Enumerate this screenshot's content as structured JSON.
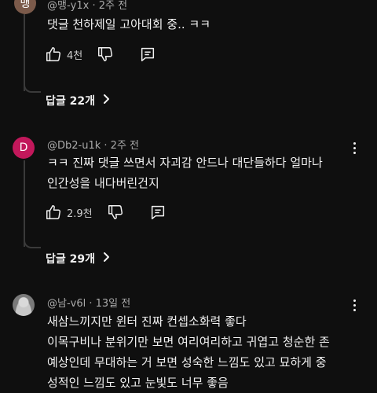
{
  "comments": [
    {
      "avatar_text": "맹",
      "avatar_color": "#7b5a4a",
      "handle": "@맹-y1x",
      "time": "2주 전",
      "lines": [
        "댓글 천하제일 고아대회 중.. ㅋㅋ"
      ],
      "likes": "4천",
      "replies_label": "답글 22개"
    },
    {
      "avatar_text": "D",
      "avatar_color": "#c2185b",
      "handle": "@Db2-u1k",
      "time": "2주 전",
      "lines": [
        "ㅋㅋ 진짜 댓글 쓰면서 자괴감 안드나 대단들하다 얼마나",
        "인간성을 내다버린건지"
      ],
      "likes": "2.9천",
      "replies_label": "답글 29개"
    },
    {
      "avatar_color": "#9a9a9a",
      "handle": "@남-v6l",
      "time": "13일 전",
      "lines": [
        "새삼느끼지만 윈터 진짜 컨셉소화력 좋다",
        "이목구비나 분위기만 보면 여리여리하고 귀엽고 청순한 존",
        "예상인데 무대하는 거 보면 성숙한 느낌도 있고 묘하게 중",
        "성적인 느낌도 있고 눈빛도 너무 좋음"
      ]
    }
  ],
  "icons": {
    "like": "thumbs-up-icon",
    "dislike": "thumbs-down-icon",
    "reply": "reply-comment-icon",
    "chevron": "chevron-right-icon",
    "more": "more-vertical-icon"
  }
}
